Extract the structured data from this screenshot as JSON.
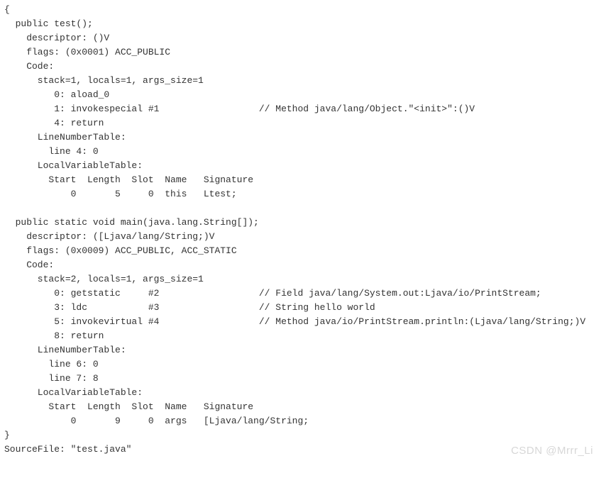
{
  "lines": [
    "{",
    "  public test();",
    "    descriptor: ()V",
    "    flags: (0x0001) ACC_PUBLIC",
    "    Code:",
    "      stack=1, locals=1, args_size=1",
    "         0: aload_0",
    "         1: invokespecial #1                  // Method java/lang/Object.\"<init>\":()V",
    "         4: return",
    "      LineNumberTable:",
    "        line 4: 0",
    "      LocalVariableTable:",
    "        Start  Length  Slot  Name   Signature",
    "            0       5     0  this   Ltest;",
    "",
    "  public static void main(java.lang.String[]);",
    "    descriptor: ([Ljava/lang/String;)V",
    "    flags: (0x0009) ACC_PUBLIC, ACC_STATIC",
    "    Code:",
    "      stack=2, locals=1, args_size=1",
    "         0: getstatic     #2                  // Field java/lang/System.out:Ljava/io/PrintStream;",
    "         3: ldc           #3                  // String hello world",
    "         5: invokevirtual #4                  // Method java/io/PrintStream.println:(Ljava/lang/String;)V",
    "         8: return",
    "      LineNumberTable:",
    "        line 6: 0",
    "        line 7: 8",
    "      LocalVariableTable:",
    "        Start  Length  Slot  Name   Signature",
    "            0       9     0  args   [Ljava/lang/String;",
    "}",
    "SourceFile: \"test.java\""
  ],
  "watermark": "CSDN @Mrrr_Li"
}
